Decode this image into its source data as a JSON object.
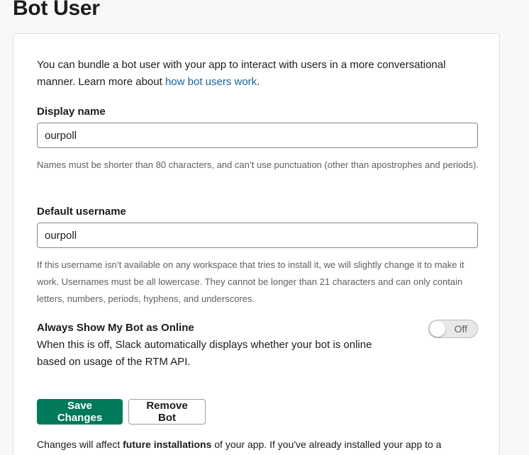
{
  "page": {
    "title": "Bot User"
  },
  "intro": {
    "text_before_link": "You can bundle a bot user with your app to interact with users in a more conversational manner. Learn more about ",
    "link_text": "how bot users work",
    "text_after_link": "."
  },
  "display_name": {
    "label": "Display name",
    "value": "ourpoll",
    "hint": "Names must be shorter than 80 characters, and can’t use punctuation (other than apostrophes and periods)."
  },
  "default_username": {
    "label": "Default username",
    "value": "ourpoll",
    "hint": "If this username isn’t available on any workspace that tries to install it, we will slightly change it to make it work. Usernames must be all lowercase. They cannot be longer than 21 characters and can only contain letters, numbers, periods, hyphens, and underscores."
  },
  "online_toggle": {
    "title": "Always Show My Bot as Online",
    "description": "When this is off, Slack automatically displays whether your bot is online based on usage of the RTM API.",
    "state_label": "Off"
  },
  "actions": {
    "save_label": "Save Changes",
    "remove_label": "Remove Bot"
  },
  "footer": {
    "text_before_bold": "Changes will affect ",
    "bold_text": "future installations",
    "text_after_bold": " of your app. If you've already installed your app to a"
  },
  "colors": {
    "primary_button": "#007a5a",
    "link": "#1264a3"
  }
}
